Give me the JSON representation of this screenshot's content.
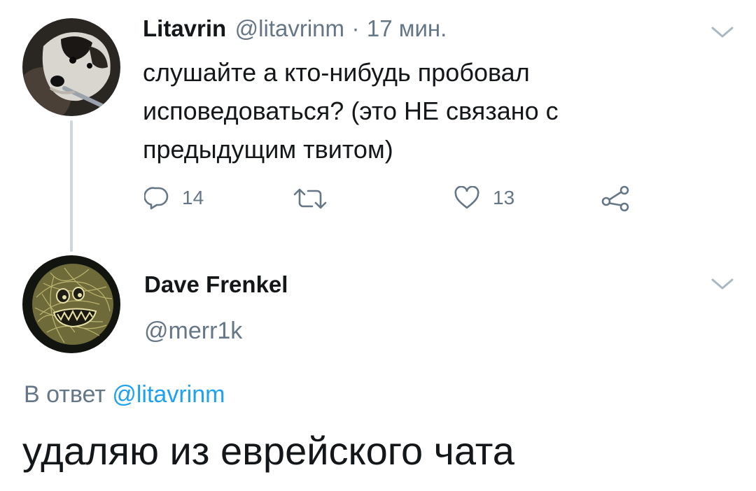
{
  "tweet1": {
    "author_name": "Litavrin",
    "author_handle": "@litavrinm",
    "separator": "·",
    "time": "17 мин.",
    "text_lines": [
      "слушайте а кто-нибудь пробовал",
      "исповедоваться? (это НЕ связано с",
      "предыдущим твитом)"
    ],
    "actions": {
      "reply_count": "14",
      "retweet_count": "",
      "like_count": "13"
    },
    "icons": {
      "reply": "reply-icon",
      "retweet": "retweet-icon",
      "like": "heart-icon",
      "share": "share-icon",
      "menu": "chevron-down-icon"
    }
  },
  "tweet2": {
    "author_name": "Dave Frenkel",
    "author_handle": "@merr1k",
    "reply_prefix": "В ответ",
    "reply_to_handle": "@litavrinm",
    "text": "удаляю из еврейского чата"
  },
  "colors": {
    "text_primary": "#14171a",
    "text_secondary": "#657786",
    "link": "#1da1f2",
    "thread_line": "#ccd6dd"
  }
}
